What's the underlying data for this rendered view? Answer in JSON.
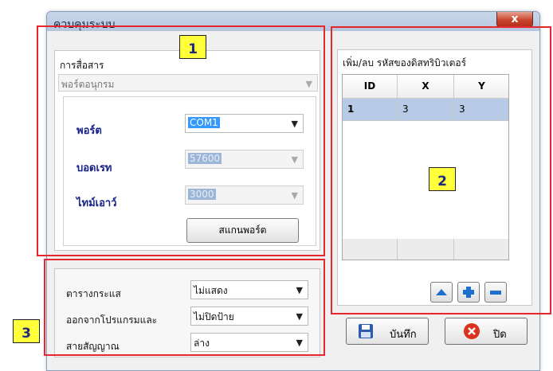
{
  "window": {
    "title": "ควบคุมระบบ",
    "close_glyph": "x"
  },
  "annotations": {
    "label_1": "1",
    "label_2": "2",
    "label_3": "3",
    "box_color": "#e8262e",
    "label_bg": "#ffff3a"
  },
  "communication": {
    "group_title": "การสื่อสาร",
    "mode_value": "พอร์ตอนุกรม",
    "port_label": "พอร์ต",
    "port_value": "COM1",
    "baud_label": "บอดเรท",
    "baud_value": "57600",
    "timeout_label": "ไทม์เอาว์",
    "timeout_value": "3000",
    "scan_button": "สแกนพอร์ต"
  },
  "distributors": {
    "group_title": "เพิ่ม/ลบ รหัสของดิสทริบิวเตอร์",
    "columns": [
      "ID",
      "X",
      "Y"
    ],
    "rows": [
      {
        "id": "1",
        "x": "3",
        "y": "3"
      }
    ],
    "up_icon": "triangle-up-icon",
    "add_icon": "plus-icon",
    "remove_icon": "minus-icon",
    "accent_color": "#1f6fd1"
  },
  "options": {
    "current_table_label": "ตารางกระแส",
    "current_table_value": "ไม่แสดง",
    "exit_program_label": "ออกจากโปรแกรมและ",
    "exit_program_value": "ไม่ปิดป้าย",
    "signal_line_label": "สายสัญญาณ",
    "signal_line_value": "ล่าง"
  },
  "actions": {
    "save_label": "บันทึก",
    "save_icon": "floppy-disk-icon",
    "close_label": "ปิด",
    "close_icon": "red-x-circle-icon"
  }
}
